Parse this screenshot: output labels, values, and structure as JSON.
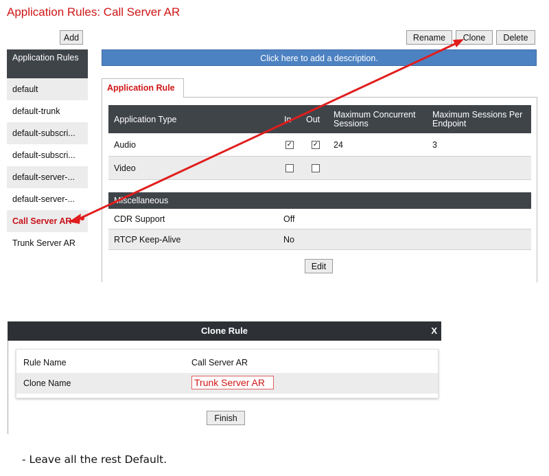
{
  "page_title": "Application Rules: Call Server AR",
  "toolbar": {
    "add": "Add",
    "rename": "Rename",
    "clone": "Clone",
    "delete": "Delete"
  },
  "sidebar": {
    "header": "Application Rules",
    "items": [
      {
        "label": "default"
      },
      {
        "label": "default-trunk"
      },
      {
        "label": "default-subscri..."
      },
      {
        "label": "default-subscri..."
      },
      {
        "label": "default-server-..."
      },
      {
        "label": "default-server-..."
      },
      {
        "label": "Call Server AR",
        "selected": true
      },
      {
        "label": "Trunk Server AR"
      }
    ]
  },
  "description_bar": "Click here to add a description.",
  "tab": "Application Rule",
  "app_table": {
    "headers": {
      "type": "Application Type",
      "in": "In",
      "out": "Out",
      "max_concurrent": "Maximum Concurrent Sessions",
      "max_per_endpoint": "Maximum Sessions Per Endpoint"
    },
    "rows": [
      {
        "type": "Audio",
        "in_checked": true,
        "out_checked": true,
        "max_concurrent": "24",
        "max_per_endpoint": "3"
      },
      {
        "type": "Video",
        "in_checked": false,
        "out_checked": false,
        "max_concurrent": "",
        "max_per_endpoint": ""
      }
    ]
  },
  "misc_table": {
    "header": "Miscellaneous",
    "rows": [
      {
        "label": "CDR Support",
        "value": "Off"
      },
      {
        "label": "RTCP Keep-Alive",
        "value": "No"
      }
    ]
  },
  "edit_button": "Edit",
  "annotation_color": "#e11d1d",
  "clone_dialog": {
    "title": "Clone Rule",
    "close": "X",
    "rule_name_label": "Rule Name",
    "rule_name_value": "Call Server AR",
    "clone_name_label": "Clone Name",
    "clone_name_value": "Trunk Server AR",
    "finish": "Finish"
  },
  "note": "-   Leave all the rest Default."
}
